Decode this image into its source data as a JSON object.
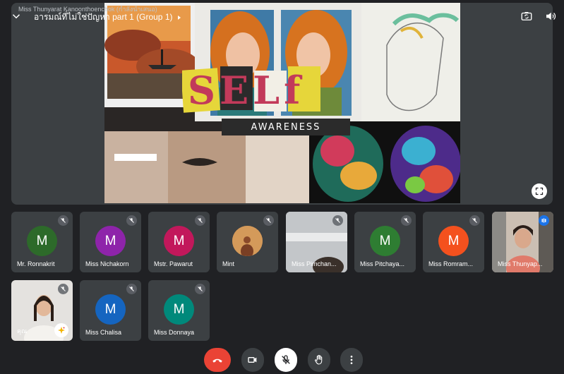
{
  "header": {
    "presenter_overlay": "Miss Thunyarat Kanoonthoenchok (กำลังนำเสนอ)",
    "meeting_title": "อารมณ์ที่ไม่ใช่ปัญหา part 1 (Group 1)"
  },
  "presentation": {
    "slide_title": "SELf",
    "slide_subtitle": "AWARENESS"
  },
  "participants": [
    {
      "name": "Mr. Ronnakrit",
      "initial": "M",
      "avatar_color": "#2d6a2a",
      "muted": true
    },
    {
      "name": "Miss Nichakorn",
      "initial": "M",
      "avatar_color": "#8e24aa",
      "muted": true
    },
    {
      "name": "Mstr. Pawarut",
      "initial": "M",
      "avatar_color": "#c2185b",
      "muted": true
    },
    {
      "name": "Mint",
      "initial": "",
      "avatar_color": "#c9874a",
      "muted": true
    },
    {
      "name": "Miss Pimchan...",
      "initial": "",
      "avatar_color": "#9aa0a6",
      "muted": true
    },
    {
      "name": "Miss Pitchaya...",
      "initial": "M",
      "avatar_color": "#2e7d32",
      "muted": true
    },
    {
      "name": "Miss Romram...",
      "initial": "M",
      "avatar_color": "#f4511e",
      "muted": true
    },
    {
      "name": "Miss Thunyap...",
      "initial": "",
      "avatar_color": "#c6b6a6",
      "muted": false
    },
    {
      "name": "คุณ",
      "initial": "",
      "avatar_color": "#d8d3cc",
      "muted": true
    },
    {
      "name": "Miss Chalisa",
      "initial": "M",
      "avatar_color": "#1565c0",
      "muted": true
    },
    {
      "name": "Miss Donnaya",
      "initial": "M",
      "avatar_color": "#00897b",
      "muted": true
    }
  ],
  "controls": {
    "end_call": "end-call-icon",
    "camera": "camera-icon",
    "microphone": "mic-off-icon",
    "raise_hand": "hand-icon",
    "more": "more-vert-icon"
  },
  "colors": {
    "background": "#202124",
    "tile": "#3c4043",
    "end_call": "#ea4335",
    "accent": "#1a73e8"
  }
}
